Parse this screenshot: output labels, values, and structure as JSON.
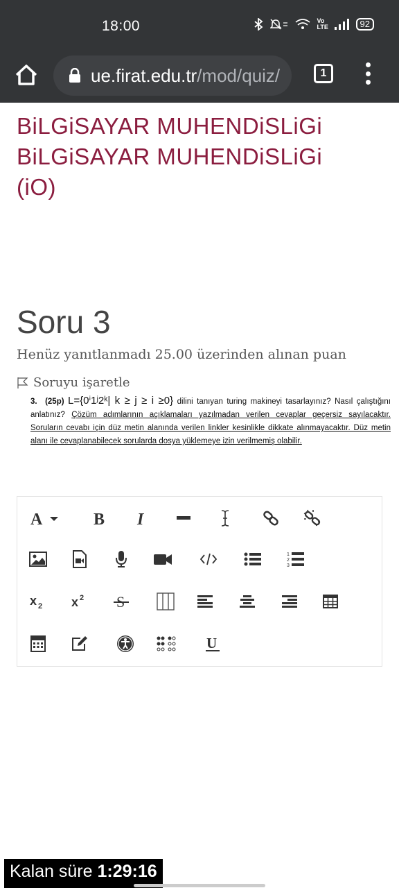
{
  "status_bar": {
    "time": "18:00",
    "network": "Vo LTE",
    "battery": "92"
  },
  "browser": {
    "url_host": "ue.firat.edu.tr",
    "url_path": "/mod/quiz/",
    "tab_count": "1"
  },
  "course": {
    "line1": "BiLGiSAYAR MUHENDiSLiGi",
    "line2": "BiLGiSAYAR MUHENDiSLiGi",
    "line3": "(iO)"
  },
  "question": {
    "title": "Soru 3",
    "state": "Henüz yanıtlanmadı  25.00 üzerinden alınan puan",
    "flag_label": "Soruyu işaretle",
    "number": "3.",
    "points": "(25p)",
    "formula": "L={0ⁱ1ʲ2ᵏ| k ≥ j ≥ i ≥0}",
    "text_plain": "dilini tanıyan turing makineyi tasarlayınız? Nasıl çalıştığını anlatınız?",
    "text_underlined": "Çözüm adımlarının açıklamaları yazılmadan verilen cevaplar geçersiz sayılacaktır. Soruların cevabı için düz metin alanında verilen linkler kesinlikle dikkate alınmayacaktır. Düz metin alanı ile cevaplanabilecek sorularda dosya yüklemeye izin verilmemiş olabilir."
  },
  "editor": {
    "toolbar": [
      [
        "font-color",
        "bold",
        "italic",
        "strikethrough-line",
        "clear-format",
        "link",
        "unlink"
      ],
      [
        "image",
        "media",
        "microphone",
        "video",
        "code",
        "bullet-list",
        "numbered-list"
      ],
      [
        "subscript",
        "superscript",
        "strikethrough",
        "table-columns",
        "align-left",
        "align-center",
        "align-right",
        "table"
      ],
      [
        "calculator",
        "edit",
        "accessibility",
        "braille",
        "underline"
      ]
    ]
  },
  "timer": {
    "label": "Kalan süre",
    "value": "1:29:16"
  }
}
